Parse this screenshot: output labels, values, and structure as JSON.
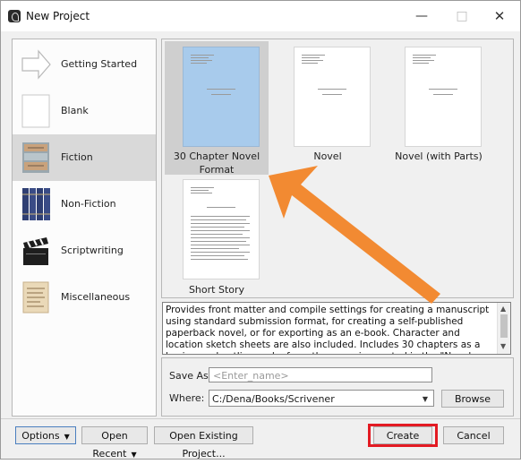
{
  "window": {
    "title": "New Project"
  },
  "categories": [
    {
      "label": "Getting Started",
      "icon": "arrow-icon"
    },
    {
      "label": "Blank",
      "icon": "blank-page-icon"
    },
    {
      "label": "Fiction",
      "icon": "fiction-books-icon",
      "selected": true
    },
    {
      "label": "Non-Fiction",
      "icon": "nonfiction-books-icon"
    },
    {
      "label": "Scriptwriting",
      "icon": "clapperboard-icon"
    },
    {
      "label": "Miscellaneous",
      "icon": "parchment-icon"
    }
  ],
  "templates": [
    {
      "label": "30 Chapter Novel Format",
      "selected": true
    },
    {
      "label": "Novel"
    },
    {
      "label": "Novel (with Parts)"
    },
    {
      "label": "Short Story"
    }
  ],
  "description": "Provides front matter and compile settings for creating a manuscript using standard submission format, for creating a self-published paperback novel, or for exporting as an e-book. Character and location sketch sheets are also included. Includes 30 chapters as a basic novel outline and a few other surprises noted in the \"Novel Format\" document.",
  "form": {
    "save_as_label": "Save As:",
    "save_as_placeholder": "<Enter_name>",
    "where_label": "Where:",
    "where_value": "C:/Dena/Books/Scrivener",
    "browse_label": "Browse"
  },
  "footer": {
    "options_label": "Options",
    "open_recent_label": "Open Recent",
    "open_existing_label": "Open Existing Project...",
    "create_label": "Create",
    "cancel_label": "Cancel"
  },
  "colors": {
    "selection_blue": "#a8cbec",
    "annotation_arrow": "#f28a32",
    "highlight_box": "#e31b23"
  }
}
